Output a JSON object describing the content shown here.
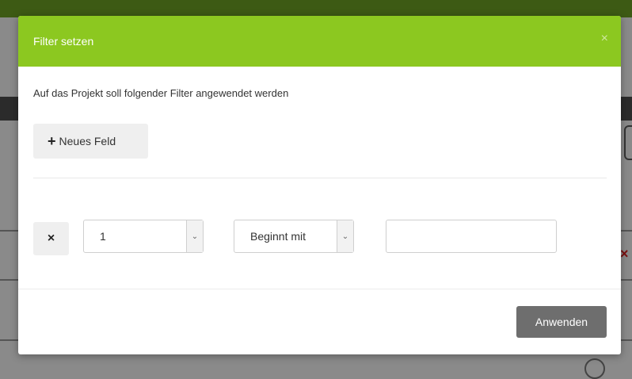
{
  "modal": {
    "title": "Filter setzen",
    "close_glyph": "×",
    "description": "Auf das Projekt soll folgender Filter angewendet werden",
    "new_field_icon": "plus-icon",
    "new_field_label": "Neues Feld",
    "filter_row": {
      "remove_glyph": "×",
      "field_value": "1",
      "operator_value": "Beginnt mit",
      "text_value": ""
    },
    "apply_label": "Anwenden"
  },
  "colors": {
    "header_green": "#8cc820",
    "apply_button": "#6e6e6e"
  }
}
